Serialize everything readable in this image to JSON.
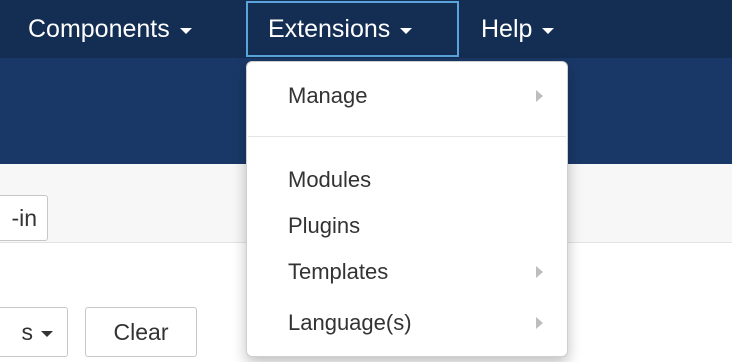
{
  "navbar": {
    "items": [
      {
        "label": "Components"
      },
      {
        "label": "Extensions"
      },
      {
        "label": "Help"
      }
    ]
  },
  "toolbar": {
    "login_label": "-in",
    "filter_label": "s",
    "clear_label": "Clear"
  },
  "dropdown": {
    "items": [
      {
        "label": "Manage",
        "submenu": true
      },
      {
        "label": "Modules",
        "submenu": false
      },
      {
        "label": "Plugins",
        "submenu": false
      },
      {
        "label": "Templates",
        "submenu": true
      },
      {
        "label": "Language(s)",
        "submenu": true
      }
    ]
  },
  "colors": {
    "navbar_bg": "#132e52",
    "subheader_bg": "#1a3867",
    "active_border": "#5aa3db"
  }
}
